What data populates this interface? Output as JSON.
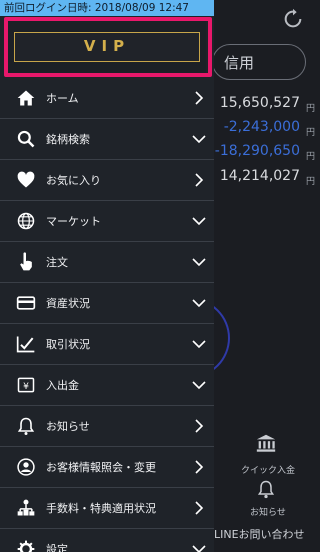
{
  "status_bar": {
    "last_login": "前回ログイン日時: 2018/08/09 12:47"
  },
  "vip": {
    "label": "VIP"
  },
  "menu": [
    {
      "label": "ホーム",
      "icon": "home-icon",
      "arrow": "right"
    },
    {
      "label": "銘柄検索",
      "icon": "search-icon",
      "arrow": "down"
    },
    {
      "label": "お気に入り",
      "icon": "heart-icon",
      "arrow": "right"
    },
    {
      "label": "マーケット",
      "icon": "globe-icon",
      "arrow": "down"
    },
    {
      "label": "注文",
      "icon": "hand-pointer-icon",
      "arrow": "down"
    },
    {
      "label": "資産状況",
      "icon": "credit-card-icon",
      "arrow": "down"
    },
    {
      "label": "取引状況",
      "icon": "chart-check-icon",
      "arrow": "down"
    },
    {
      "label": "入出金",
      "icon": "yen-deposit-icon",
      "arrow": "down"
    },
    {
      "label": "お知らせ",
      "icon": "bell-icon",
      "arrow": "right"
    },
    {
      "label": "お客様情報照会・変更",
      "icon": "user-circle-icon",
      "arrow": "right"
    },
    {
      "label": "手数料・特典適用状況",
      "icon": "org-chart-icon",
      "arrow": "right"
    },
    {
      "label": "設定",
      "icon": "gear-icon",
      "arrow": "down"
    }
  ],
  "background": {
    "credit_label": "信用",
    "amounts": [
      "15,650,527",
      "-2,243,000",
      "-18,290,650",
      "14,214,027"
    ],
    "unit": "円",
    "quick_deposit": "クイック入金",
    "notice": "お知らせ",
    "line_inquiry": "LINEお問い合わせ"
  },
  "colors": {
    "accent_pink": "#e8186b",
    "vip_gold": "#c7a54a",
    "status_blue": "#5fb6f2",
    "negative_blue": "#3b6ed8"
  }
}
